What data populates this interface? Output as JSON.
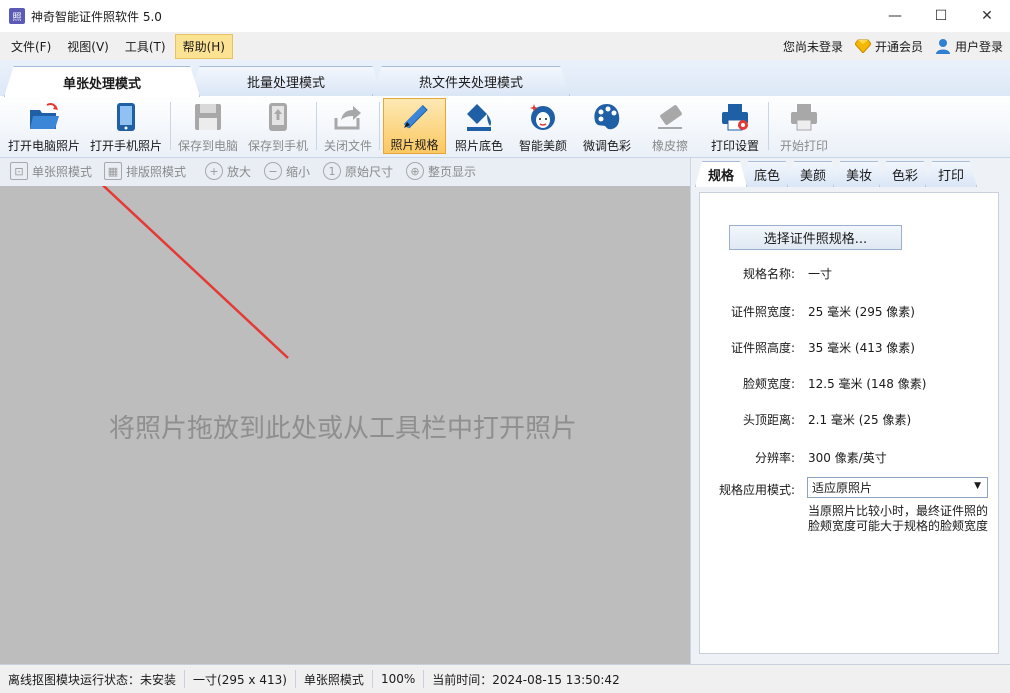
{
  "window": {
    "title": "神奇智能证件照软件 5.0",
    "app_icon_text": "照",
    "minimize": "—",
    "maximize": "☐",
    "close": "✕"
  },
  "menu": {
    "items": [
      "文件(F)",
      "视图(V)",
      "工具(T)",
      "帮助(H)"
    ],
    "login_status": "您尚未登录",
    "vip_label": "开通会员",
    "user_login_label": "用户登录"
  },
  "mode_tabs": [
    "单张处理模式",
    "批量处理模式",
    "热文件夹处理模式"
  ],
  "toolbar": {
    "items": [
      {
        "label": "打开电脑照片",
        "icon": "folder-open-icon"
      },
      {
        "label": "打开手机照片",
        "icon": "phone-icon"
      },
      {
        "label": "保存到电脑",
        "icon": "save-icon"
      },
      {
        "label": "保存到手机",
        "icon": "phone-upload-icon"
      },
      {
        "label": "关闭文件",
        "icon": "close-file-icon"
      },
      {
        "label": "照片规格",
        "icon": "ruler-pencil-icon"
      },
      {
        "label": "照片底色",
        "icon": "paint-bucket-icon"
      },
      {
        "label": "智能美颜",
        "icon": "face-beauty-icon"
      },
      {
        "label": "微调色彩",
        "icon": "palette-icon"
      },
      {
        "label": "橡皮擦",
        "icon": "eraser-icon"
      },
      {
        "label": "打印设置",
        "icon": "printer-settings-icon"
      },
      {
        "label": "开始打印",
        "icon": "printer-icon"
      }
    ]
  },
  "subtoolbar": {
    "items": [
      "单张照模式",
      "排版照模式",
      "放大",
      "缩小",
      "原始尺寸",
      "整页显示"
    ]
  },
  "canvas": {
    "drop_hint": "将照片拖放到此处或从工具栏中打开照片"
  },
  "panel": {
    "tabs": [
      "规格",
      "底色",
      "美颜",
      "美妆",
      "色彩",
      "打印"
    ],
    "select_spec_button": "选择证件照规格...",
    "specs": [
      {
        "label": "规格名称:",
        "value": "一寸"
      },
      {
        "label": "证件照宽度:",
        "value": "25 毫米 (295 像素)"
      },
      {
        "label": "证件照高度:",
        "value": "35 毫米 (413 像素)"
      },
      {
        "label": "脸颊宽度:",
        "value": "12.5 毫米 (148 像素)"
      },
      {
        "label": "头顶距离:",
        "value": "2.1 毫米 (25 像素)"
      },
      {
        "label": "分辨率:",
        "value": "300 像素/英寸"
      }
    ],
    "mode_label": "规格应用模式:",
    "mode_value": "适应原照片",
    "mode_note": "当原照片比较小时，最终证件照的脸颊宽度可能大于规格的脸颊宽度"
  },
  "status": {
    "module_state": "离线抠图模块运行状态：未安装",
    "size": "一寸(295 x 413)",
    "mode": "单张照模式",
    "zoom": "100%",
    "time": "当前时间：2024-08-15 13:50:42"
  },
  "colors": {
    "accent_red_arrow": "#e53935",
    "canvas_bg": "#bdbdbd",
    "active_tool": "#fbc862"
  }
}
